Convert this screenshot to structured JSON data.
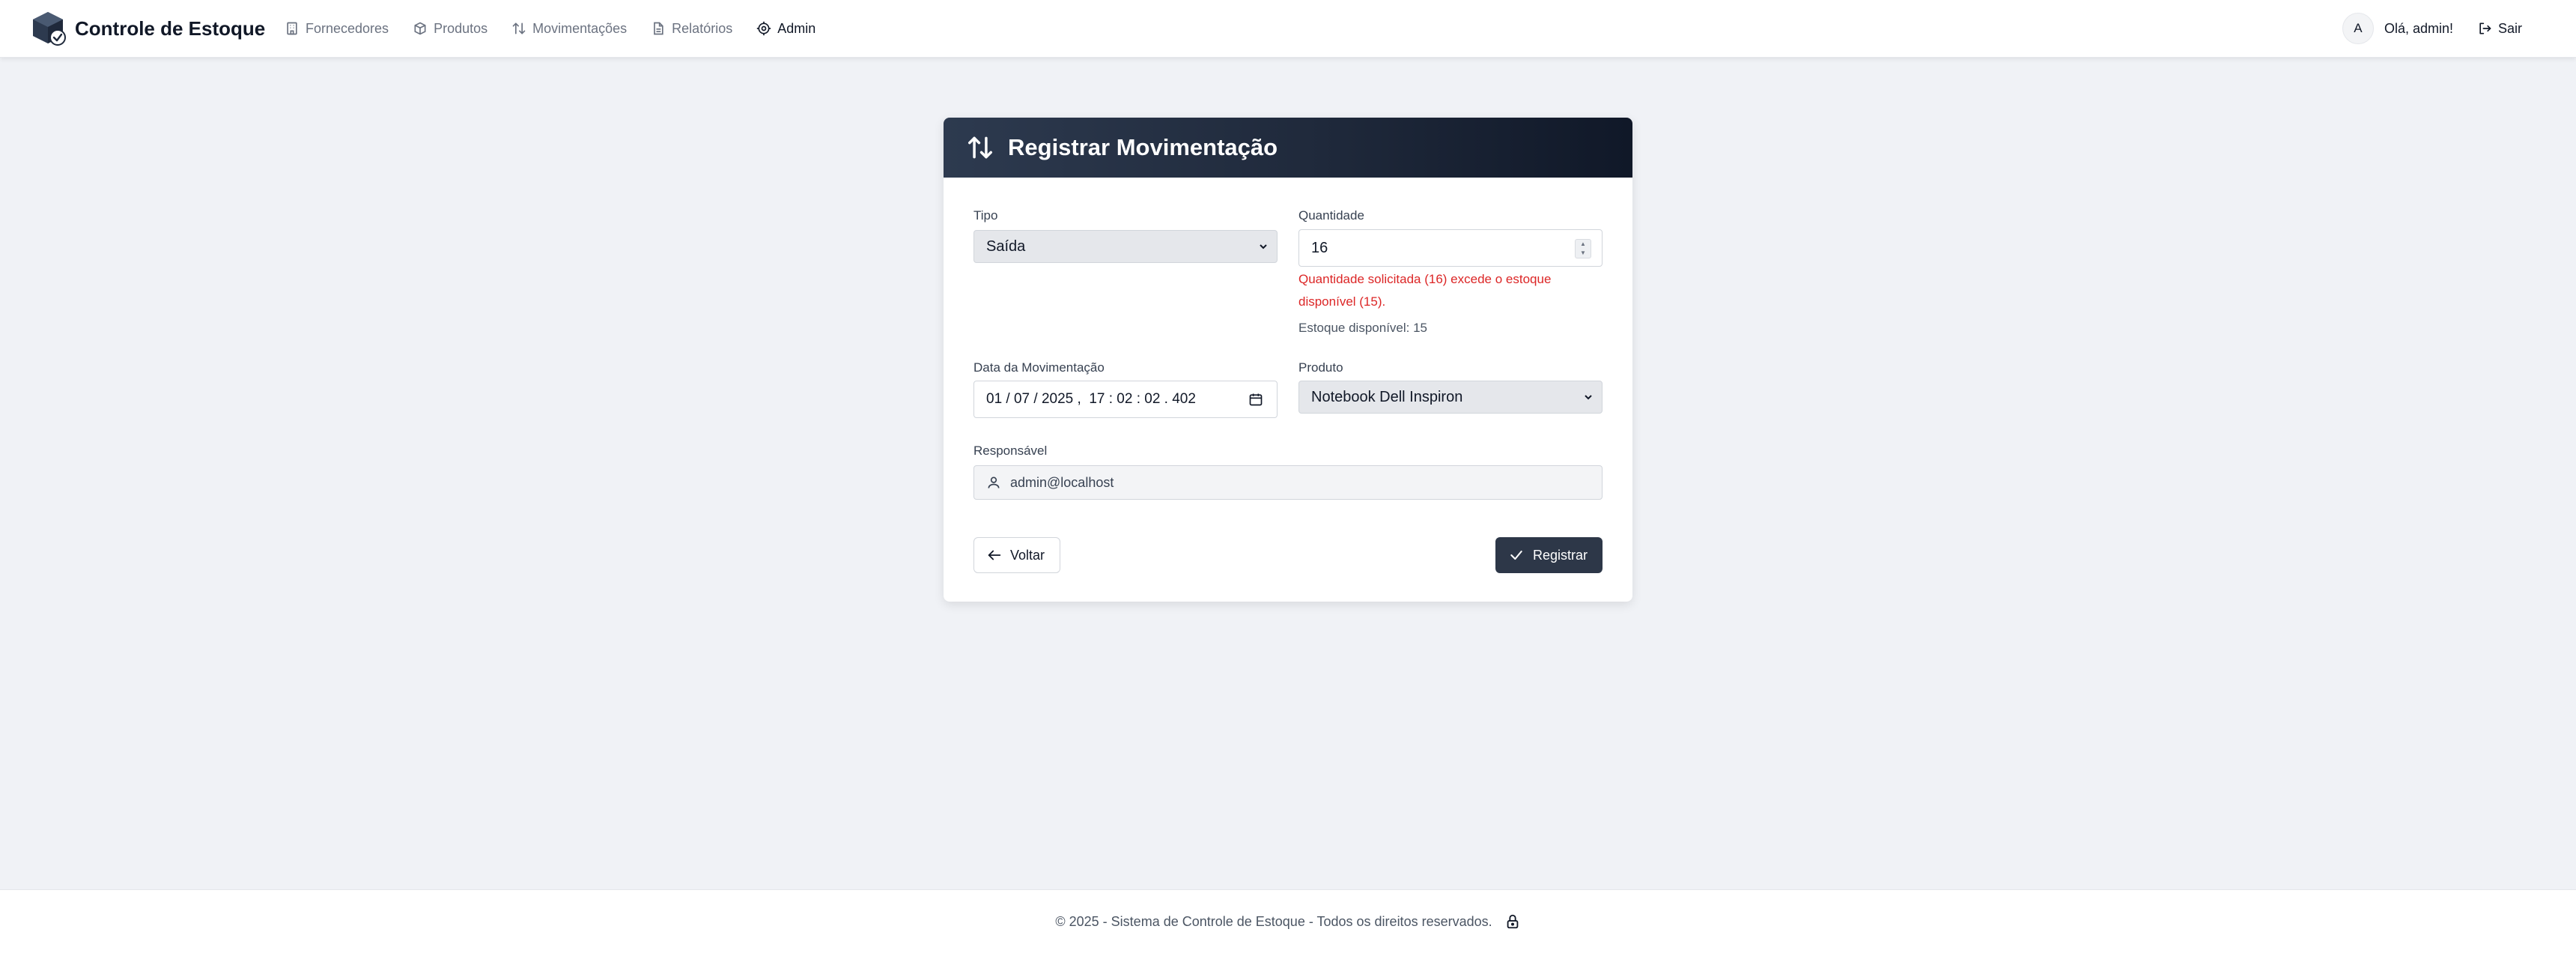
{
  "app": {
    "title": "Controle de Estoque"
  },
  "nav": {
    "items": [
      {
        "label": "Fornecedores",
        "icon": "building-icon"
      },
      {
        "label": "Produtos",
        "icon": "box-icon"
      },
      {
        "label": "Movimentações",
        "icon": "arrows-updown-icon"
      },
      {
        "label": "Relatórios",
        "icon": "document-icon"
      },
      {
        "label": "Admin",
        "icon": "gear-icon"
      }
    ],
    "avatar_letter": "A",
    "greeting": "Olá, admin!",
    "logout_label": "Sair"
  },
  "form": {
    "title": "Registrar Movimentação",
    "tipo": {
      "label": "Tipo",
      "value": "Saída"
    },
    "quantidade": {
      "label": "Quantidade",
      "value": "16",
      "error": "Quantidade solicitada (16) excede o estoque disponível (15).",
      "stock_info": "Estoque disponível: 15"
    },
    "data": {
      "label": "Data da Movimentação",
      "value": "01 / 07 / 2025 ,  17 : 02 : 02 . 402"
    },
    "produto": {
      "label": "Produto",
      "value": "Notebook Dell Inspiron"
    },
    "responsavel": {
      "label": "Responsável",
      "value": "admin@localhost"
    },
    "back_label": "Voltar",
    "submit_label": "Registrar"
  },
  "footer": {
    "text": "© 2025 - Sistema de Controle de Estoque - Todos os direitos reservados."
  },
  "colors": {
    "header_dark": "#1f293b",
    "primary_button": "#2d3748",
    "error": "#dc2626",
    "page_bg": "#f0f2f6"
  }
}
